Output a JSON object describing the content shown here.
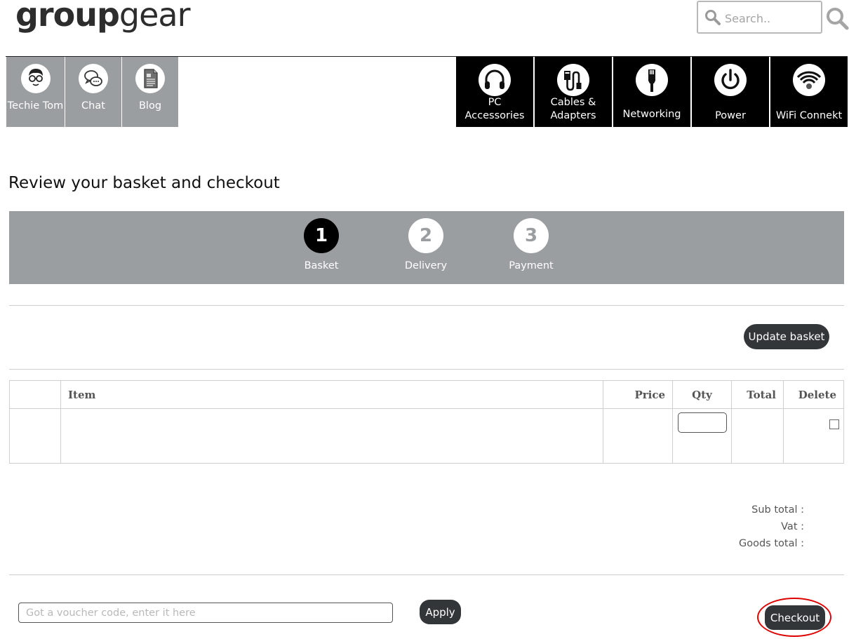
{
  "brand": {
    "logo_bold": "group",
    "logo_light": "gear"
  },
  "search": {
    "placeholder": "Search.."
  },
  "left_nav": [
    {
      "label": "Techie Tom",
      "icon": "techie-tom-avatar-icon"
    },
    {
      "label": "Chat",
      "icon": "chat-bubbles-icon"
    },
    {
      "label": "Blog",
      "icon": "document-icon"
    }
  ],
  "right_nav": [
    {
      "label": "PC Accessories",
      "icon": "headphones-icon"
    },
    {
      "label": "Cables & Adapters",
      "icon": "cable-icon"
    },
    {
      "label": "Networking",
      "icon": "ethernet-plug-icon"
    },
    {
      "label": "Power",
      "icon": "power-icon"
    },
    {
      "label": "WiFi Connekt",
      "icon": "wifi-icon"
    }
  ],
  "page": {
    "title": "Review your basket and checkout"
  },
  "steps": [
    {
      "number": "1",
      "label": "Basket",
      "active": true
    },
    {
      "number": "2",
      "label": "Delivery",
      "active": false
    },
    {
      "number": "3",
      "label": "Payment",
      "active": false
    }
  ],
  "basket": {
    "update_label": "Update basket",
    "columns": [
      "",
      "Item",
      "Price",
      "Qty",
      "Total",
      "Delete"
    ],
    "rows": [
      {
        "image": "",
        "item": "",
        "price": "",
        "qty": "",
        "total": "",
        "delete": false
      }
    ]
  },
  "totals": {
    "subtotal_label": "Sub total :",
    "vat_label": "Vat :",
    "goods_total_label": "Goods total :"
  },
  "voucher": {
    "placeholder": "Got a voucher code, enter it here",
    "apply_label": "Apply"
  },
  "checkout": {
    "label": "Checkout",
    "highlight_color": "#e00000"
  },
  "colors": {
    "nav_grey": "#9b9ea0",
    "nav_black": "#000000",
    "button_dark": "#333638"
  }
}
